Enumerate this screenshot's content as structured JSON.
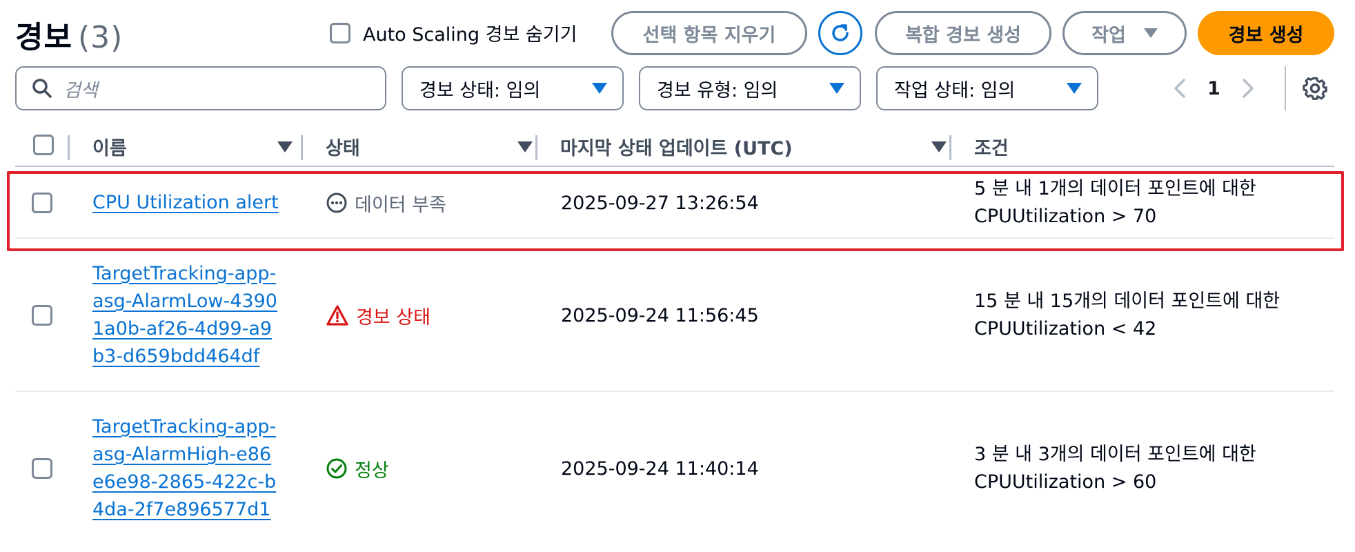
{
  "header": {
    "title": "경보",
    "count": "(3)",
    "autoscaling_label": "Auto Scaling 경보 숨기기",
    "clear_selection_label": "선택 항목 지우기",
    "composite_alarm_label": "복합 경보 생성",
    "actions_label": "작업",
    "create_alarm_label": "경보 생성"
  },
  "filters": {
    "search_placeholder": "검색",
    "alarm_state": "경보 상태: 임의",
    "alarm_type": "경보 유형: 임의",
    "action_state": "작업 상태: 임의"
  },
  "pagination": {
    "page": "1"
  },
  "table": {
    "columns": [
      "이름",
      "상태",
      "마지막 상태 업데이트 (UTC)",
      "조건"
    ],
    "rows": [
      {
        "name": "CPU Utilization alert",
        "status": "데이터 부족",
        "status_kind": "insufficient",
        "updated": "2025-09-27 13:26:54",
        "condition": "5 분 내 1개의 데이터 포인트에 대한 CPUUtilization > 70"
      },
      {
        "name": "TargetTracking-app-asg-AlarmLow-43901a0b-af26-4d99-a9b3-d659bdd464df",
        "status": "경보 상태",
        "status_kind": "alarm",
        "updated": "2025-09-24 11:56:45",
        "condition": "15 분 내 15개의 데이터 포인트에 대한 CPUUtilization < 42"
      },
      {
        "name": "TargetTracking-app-asg-AlarmHigh-e86e6e98-2865-422c-b4da-2f7e896577d1",
        "status": "정상",
        "status_kind": "ok",
        "updated": "2025-09-24 11:40:14",
        "condition": "3 분 내 3개의 데이터 포인트에 대한 CPUUtilization > 60"
      }
    ]
  },
  "colors": {
    "primary": "#ff9900",
    "link": "#0972d3",
    "alarm": "#d91515",
    "ok": "#037f0c",
    "highlight": "#e0222f"
  },
  "icons": {
    "search": "search-icon",
    "refresh": "refresh-icon",
    "settings": "gear-icon",
    "insufficient": "ellipsis-circle-icon",
    "alarm": "warning-triangle-icon",
    "ok": "check-circle-icon"
  }
}
